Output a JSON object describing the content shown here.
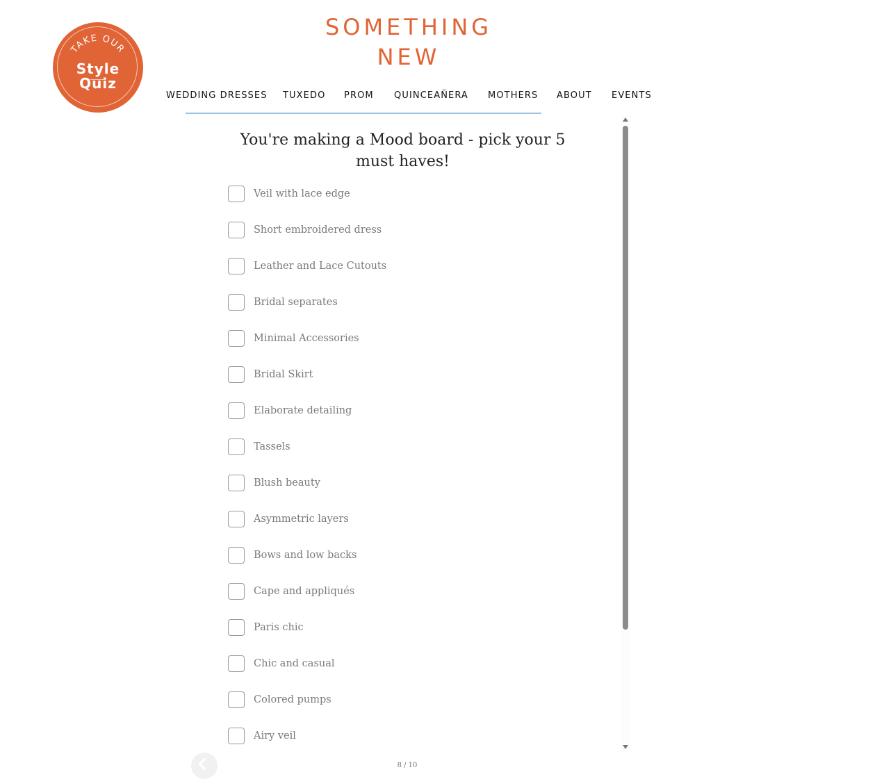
{
  "badge": {
    "arc_text": "TAKE OUR",
    "title": "Style\nQuiz",
    "color": "#e06436"
  },
  "brand": {
    "logo": "SOMETHING\nNEW",
    "color": "#e06436"
  },
  "nav": {
    "items": [
      {
        "label": "WEDDING DRESSES"
      },
      {
        "label": "TUXEDO"
      },
      {
        "label": "PROM"
      },
      {
        "label": "QUINCEAÑERA"
      },
      {
        "label": "MOTHERS"
      },
      {
        "label": "ABOUT"
      },
      {
        "label": "EVENTS"
      }
    ]
  },
  "quiz": {
    "question": "You're making a Mood board - pick your 5 must haves!",
    "options": [
      {
        "label": "Veil with lace edge",
        "checked": false
      },
      {
        "label": "Short embroidered dress",
        "checked": false
      },
      {
        "label": "Leather and Lace Cutouts",
        "checked": false
      },
      {
        "label": "Bridal separates",
        "checked": false
      },
      {
        "label": "Minimal Accessories",
        "checked": false
      },
      {
        "label": "Bridal Skirt",
        "checked": false
      },
      {
        "label": "Elaborate detailing",
        "checked": false
      },
      {
        "label": "Tassels",
        "checked": false
      },
      {
        "label": "Blush beauty",
        "checked": false
      },
      {
        "label": "Asymmetric layers",
        "checked": false
      },
      {
        "label": "Bows and low backs",
        "checked": false
      },
      {
        "label": "Cape and appliqués",
        "checked": false
      },
      {
        "label": "Paris chic",
        "checked": false
      },
      {
        "label": "Chic and casual",
        "checked": false
      },
      {
        "label": "Colored pumps",
        "checked": false
      },
      {
        "label": "Airy veil",
        "checked": false
      }
    ],
    "progress": "8 / 10"
  }
}
